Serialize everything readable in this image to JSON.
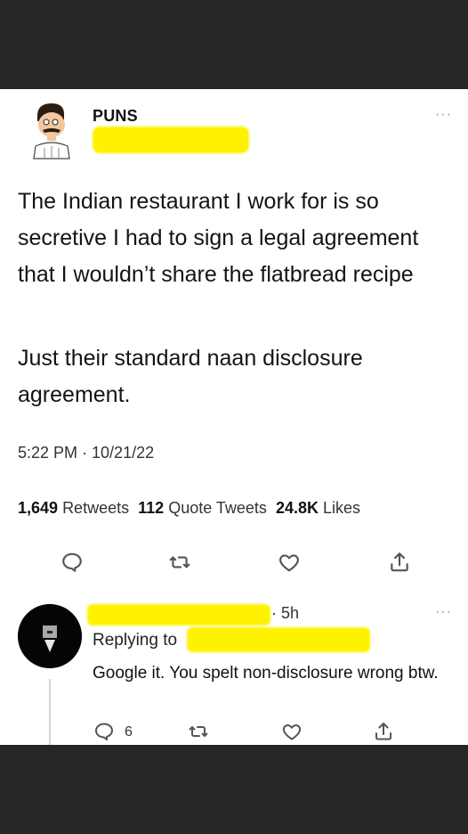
{
  "tweet": {
    "display_name": "PUNS",
    "text_p1": "The Indian restaurant I work for is so secretive I had to sign a legal agreement that I wouldn’t share the flatbread recipe",
    "text_p2": "Just their standard naan disclosure agreement.",
    "timestamp": "5:22 PM · 10/21/22",
    "retweets_count": "1,649",
    "retweets_label": "Retweets",
    "quotes_count": "112",
    "quotes_label": "Quote Tweets",
    "likes_count": "24.8K",
    "likes_label": "Likes",
    "more": "···"
  },
  "reply": {
    "time": "· 5h",
    "replying_to": "Replying to",
    "text": "Google it. You spelt non-disclosure wrong btw.",
    "reply_count": "6",
    "more": "···"
  },
  "colors": {
    "redaction": "#fff200",
    "background": "#262626",
    "card": "#ffffff",
    "icon": "#666666"
  },
  "icons": [
    "reply-icon",
    "retweet-icon",
    "like-icon",
    "share-icon",
    "more-icon"
  ]
}
